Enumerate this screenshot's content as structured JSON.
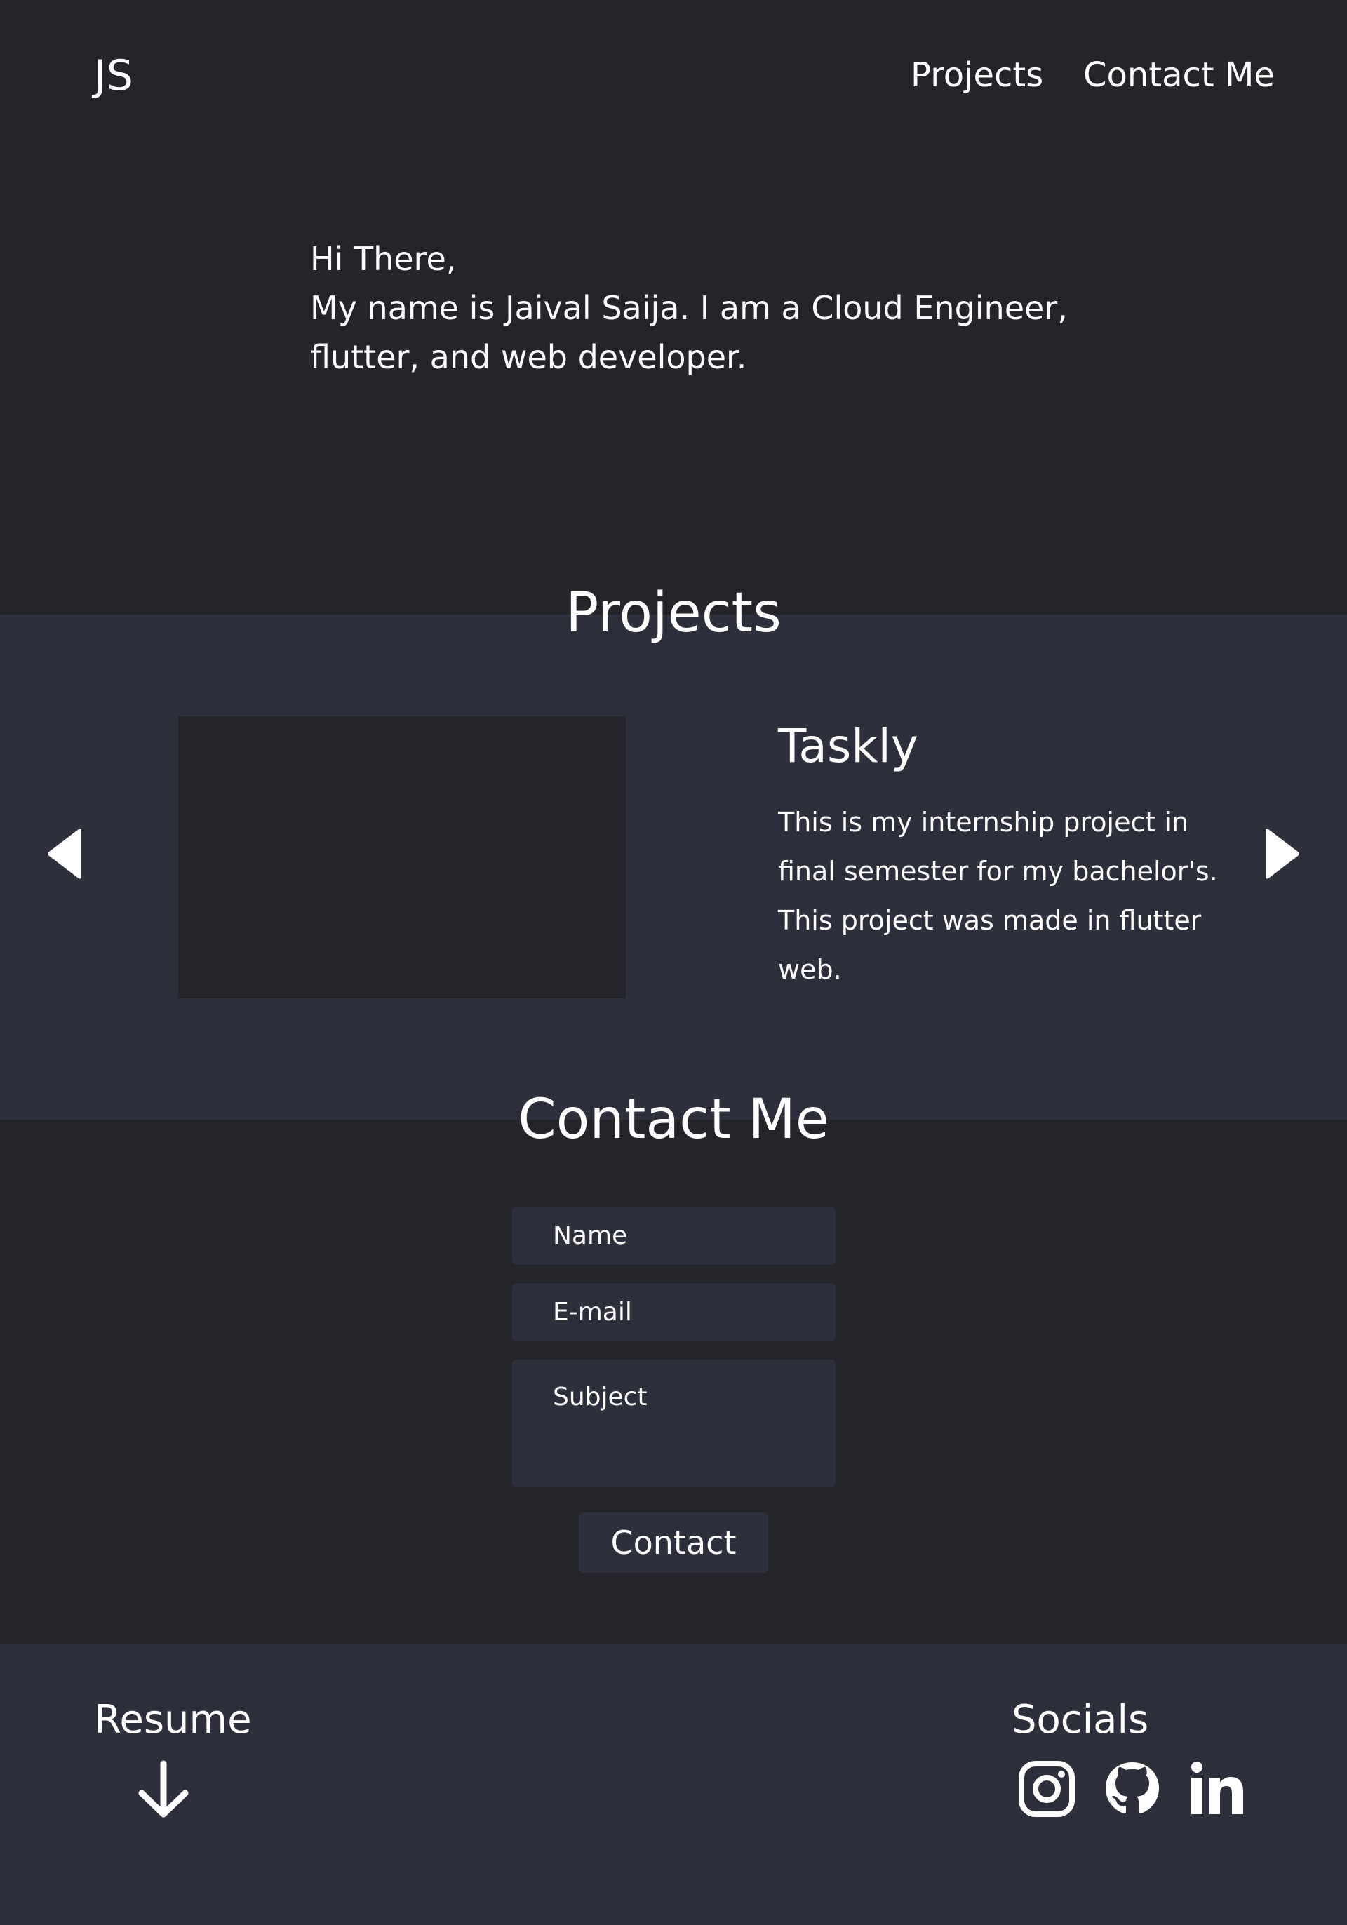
{
  "header": {
    "logo": "JS",
    "nav": [
      {
        "label": "Projects"
      },
      {
        "label": "Contact Me"
      }
    ]
  },
  "hero": {
    "lines": [
      "Hi There,",
      "My name is Jaival Saija. I am a Cloud Engineer,",
      "flutter, and web developer."
    ]
  },
  "projects": {
    "title": "Projects",
    "current": {
      "name": "Taskly",
      "description_lines": [
        "This is my internship project in",
        "final semester for my bachelor's.",
        "This project was made in flutter",
        "web."
      ]
    },
    "prev_icon": "triangle-left-icon",
    "next_icon": "triangle-right-icon"
  },
  "contact": {
    "title": "Contact Me",
    "name_placeholder": "Name",
    "email_placeholder": "E-mail",
    "subject_placeholder": "Subject",
    "button_label": "Contact"
  },
  "footer": {
    "resume_label": "Resume",
    "resume_icon": "arrow-down-icon",
    "socials_label": "Socials",
    "socials": [
      {
        "icon": "instagram-icon"
      },
      {
        "icon": "github-icon"
      },
      {
        "icon": "linkedin-icon"
      }
    ]
  },
  "colors": {
    "background": "#24252b",
    "panel": "#2d2f3c",
    "text": "#ffffff"
  }
}
